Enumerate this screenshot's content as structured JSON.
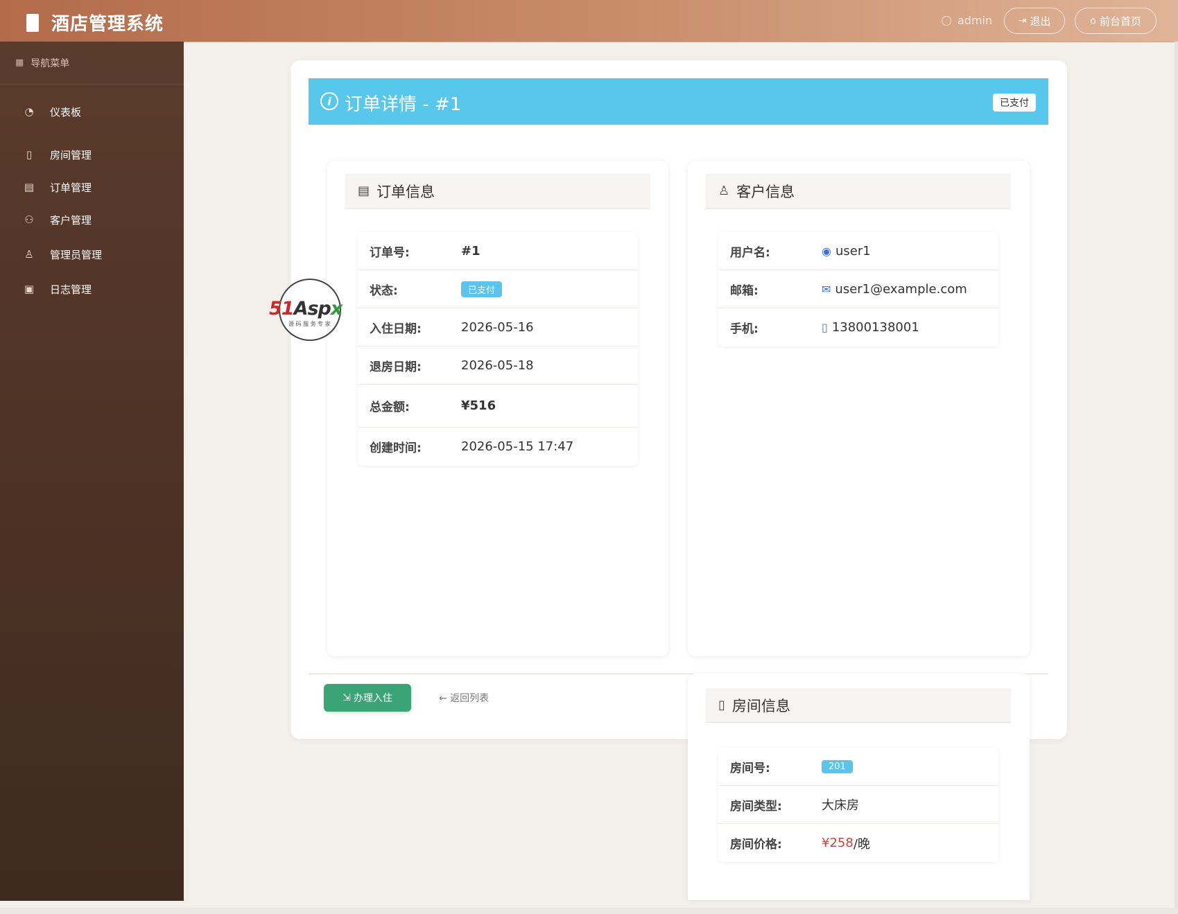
{
  "header": {
    "title": "酒店管理系统",
    "user": "admin",
    "logout": "退出",
    "home": "前台首页"
  },
  "sidebar": {
    "heading": "导航菜单",
    "items": [
      {
        "label": "仪表板",
        "icon": "dashboard-icon"
      },
      {
        "label": "房间管理",
        "icon": "door-icon"
      },
      {
        "label": "订单管理",
        "icon": "list-icon"
      },
      {
        "label": "客户管理",
        "icon": "people-icon"
      },
      {
        "label": "管理员管理",
        "icon": "admin-icon"
      },
      {
        "label": "日志管理",
        "icon": "journal-icon"
      }
    ]
  },
  "order": {
    "heading": "订单详情 - #1",
    "status_badge": "已支付",
    "info_title": "订单信息",
    "fields": {
      "id_label": "订单号:",
      "id_value": "#1",
      "status_label": "状态:",
      "status_value": "已支付",
      "checkin_label": "入住日期:",
      "checkin_value": "2026-05-16",
      "checkout_label": "退房日期:",
      "checkout_value": "2026-05-18",
      "total_label": "总金额:",
      "total_value": "¥516",
      "created_label": "创建时间:",
      "created_value": "2026-05-15 17:47"
    }
  },
  "customer": {
    "title": "客户信息",
    "username_label": "用户名:",
    "username_value": "user1",
    "email_label": "邮箱:",
    "email_value": "user1@example.com",
    "phone_label": "手机:",
    "phone_value": "13800138001"
  },
  "room": {
    "title": "房间信息",
    "number_label": "房间号:",
    "number_value": "201",
    "type_label": "房间类型:",
    "type_value": "大床房",
    "price_label": "房间价格:",
    "price_value": "¥258",
    "price_unit": "/晚"
  },
  "actions": {
    "checkin": "办理入住",
    "back": "← 返回列表"
  },
  "watermark": {
    "brand_a": "51",
    "brand_b": "Asp",
    "brand_c": "x",
    "sub": "源 码 服 务 专 家"
  },
  "colors": {
    "accent": "#58c7ec",
    "price": "#d2413a",
    "success": "#3aa477"
  }
}
